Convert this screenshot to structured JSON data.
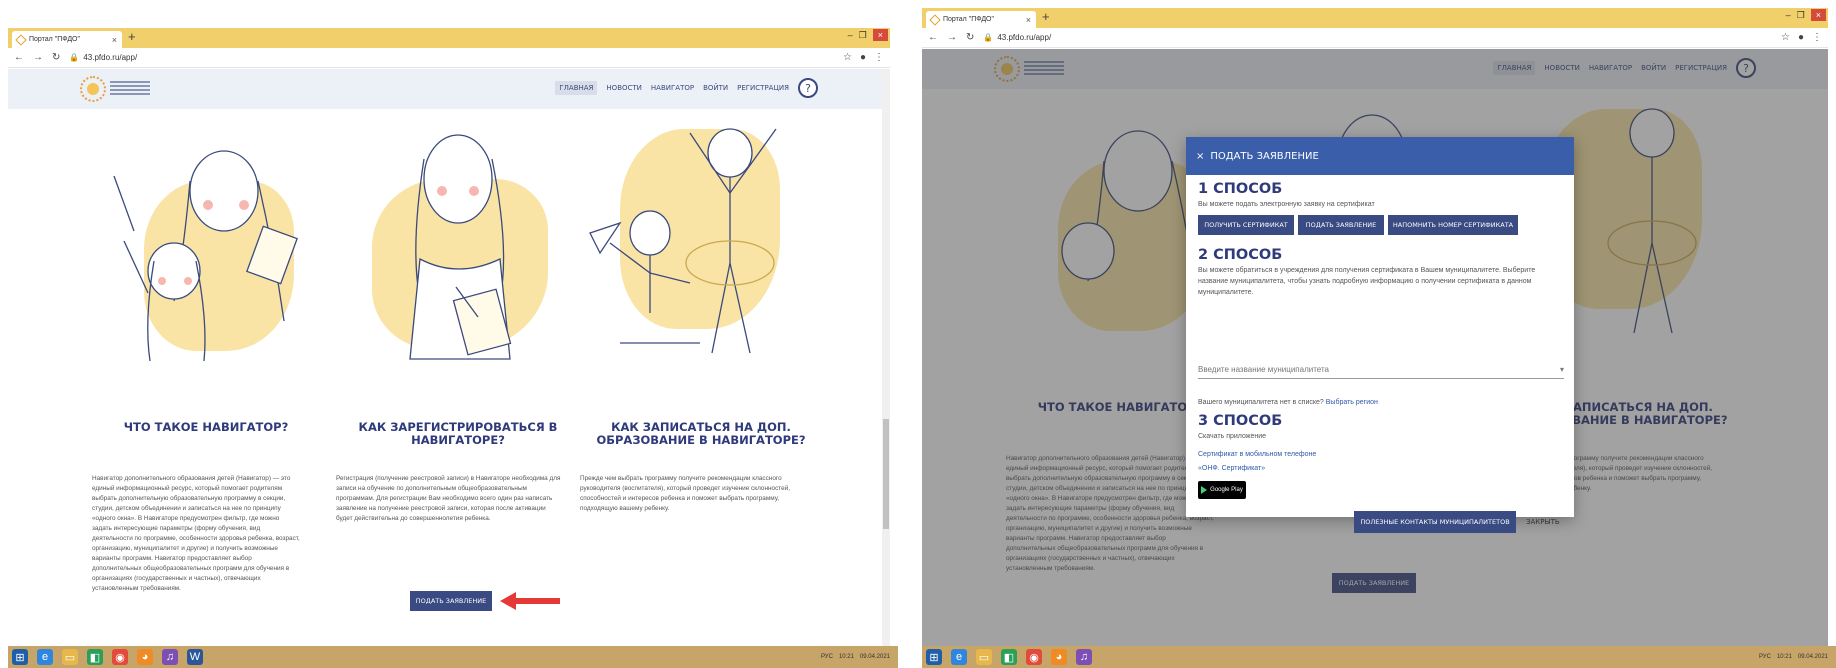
{
  "browser": {
    "tab_title": "Портал \"ПФДО\"",
    "tab_close": "×",
    "new_tab": "+",
    "url": "43.pfdo.ru/app/",
    "minimize": "–",
    "restore": "❐",
    "close": "×"
  },
  "site": {
    "nav": [
      "ГЛАВНАЯ",
      "НОВОСТИ",
      "НАВИГАТОР",
      "ВОЙТИ",
      "РЕГИСТРАЦИЯ"
    ],
    "help": "?"
  },
  "columns": [
    {
      "title": "ЧТО ТАКОЕ НАВИГАТОР?",
      "text": "Навигатор дополнительного образования детей (Навигатор) — это единый информационный ресурс, который помогает родителям выбрать дополнительную образовательную программу в секции, студии, детском объединении и записаться на нее по принципу «одного окна». В Навигаторе предусмотрен фильтр, где можно задать интересующие параметры (форму обучения, вид деятельности по программе, особенности здоровья ребенка, возраст, организацию, муниципалитет и другие) и получить возможные варианты программ. Навигатор предоставляет выбор дополнительных общеобразовательных программ для обучения в организациях (государственных и частных), отвечающих установленным требованиям."
    },
    {
      "title": "КАК ЗАРЕГИСТРИРОВАТЬСЯ В НАВИГАТОРЕ?",
      "text": "Регистрация (получение реестровой записи) в Навигаторе необходима для записи на обучение по дополнительным общеобразовательным программам. Для регистрации Вам необходимо всего один раз написать заявление на получение реестровой записи, которая после активации будет действительна до совершеннолетия ребенка."
    },
    {
      "title": "КАК ЗАПИСАТЬСЯ НА ДОП. ОБРАЗОВАНИЕ В НАВИГАТОРЕ?",
      "text": "Прежде чем выбрать программу получите рекомендации классного руководителя (воспитателя), который проведет изучение склонностей, способностей и интересов ребенка и поможет выбрать программу, подходящую вашему ребенку."
    }
  ],
  "cta": {
    "label": "ПОДАТЬ ЗАЯВЛЕНИЕ"
  },
  "modal": {
    "close_x": "×",
    "title": "ПОДАТЬ ЗАЯВЛЕНИЕ",
    "way1": {
      "heading": "1 СПОСОБ",
      "text": "Вы можете подать электронную заявку на сертификат",
      "buttons": [
        "ПОЛУЧИТЬ СЕРТИФИКАТ",
        "ПОДАТЬ ЗАЯВЛЕНИЕ",
        "НАПОМНИТЬ НОМЕР СЕРТИФИКАТА"
      ]
    },
    "way2": {
      "heading": "2 СПОСОБ",
      "text": "Вы можете обратиться в учреждения для получения сертификата в Вашем муниципалитете. Выберите название муниципалитета, чтобы узнать подробную информацию о получении сертификата в данном муниципалитете.",
      "select_placeholder": "Введите название муниципалитета",
      "select_caret": "▾",
      "missing_text": "Вашего муниципалитета нет в списке?",
      "missing_link": "Выбрать регион"
    },
    "way3": {
      "heading": "3 СПОСОБ",
      "text": "Скачать приложение",
      "link1": "Сертификат в мобильном телефоне",
      "link2": "«ОНФ. Сертификат»",
      "store_badge": "Google Play"
    },
    "footer_contacts": "ПОЛЕЗНЫЕ КОНТАКТЫ МУНИЦИПАЛИТЕТОВ",
    "footer_close": "ЗАКРЫТЬ"
  },
  "taskbar": {
    "lang": "РУС",
    "time": "10:21",
    "date": "09.04.2021"
  },
  "colors": {
    "accent": "#3a4a82",
    "modal_header": "#3a5ea9",
    "tab_bar": "#f1cf6b",
    "arrow": "#e53935"
  }
}
